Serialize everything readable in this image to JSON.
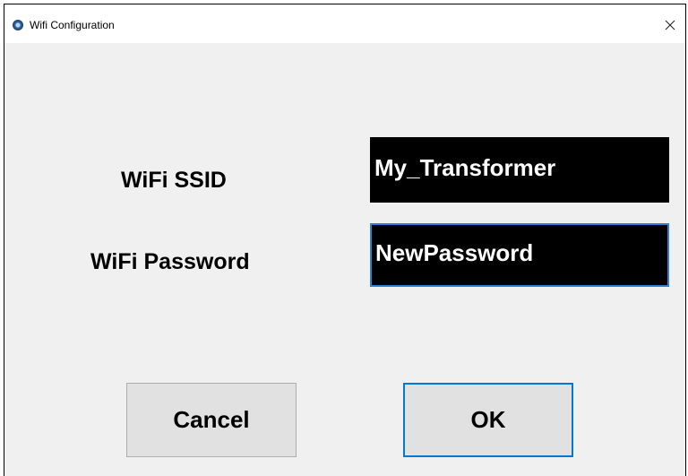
{
  "window": {
    "title": "Wifi Configuration",
    "close_icon": "close-icon",
    "app_icon": "app-icon"
  },
  "form": {
    "ssid_label": "WiFi SSID",
    "ssid_value": "My_Transformer",
    "password_label": "WiFi Password",
    "password_value": "NewPassword"
  },
  "buttons": {
    "cancel_label": "Cancel",
    "ok_label": "OK"
  },
  "colors": {
    "field_background": "#000000",
    "field_text": "#ffffff",
    "focus_border": "#0078d7",
    "window_background": "#f0f0f0"
  }
}
